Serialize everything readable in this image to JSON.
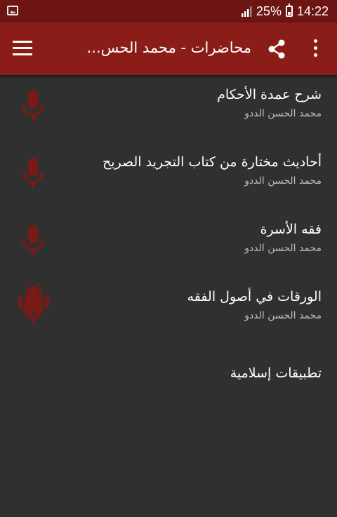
{
  "status_bar": {
    "battery": "25%",
    "time": "14:22"
  },
  "app_bar": {
    "title": "محاضرات - محمد الحس..."
  },
  "items": [
    {
      "title": "شرح عمدة الأحكام",
      "author": "محمد الحسن الددو",
      "icon": "microphone-icon"
    },
    {
      "title": "أحاديث مختارة من كتاب التجريد الصريح",
      "author": "محمد الحسن الددو",
      "icon": "microphone-icon"
    },
    {
      "title": "فقه الأسرة",
      "author": "محمد الحسن الددو",
      "icon": "microphone-icon"
    },
    {
      "title": "الورقات في أصول الفقه",
      "author": "محمد الحسن الددو",
      "icon": "microphone-icon"
    }
  ],
  "more_apps": {
    "title": "تطبيقات إسلامية",
    "icon": "android-icon"
  },
  "colors": {
    "status_bar": "#6d1512",
    "app_bar": "#8b1d19",
    "background": "#303030",
    "icon_accent": "#7a1a17",
    "subtitle": "#bdbdbd"
  }
}
